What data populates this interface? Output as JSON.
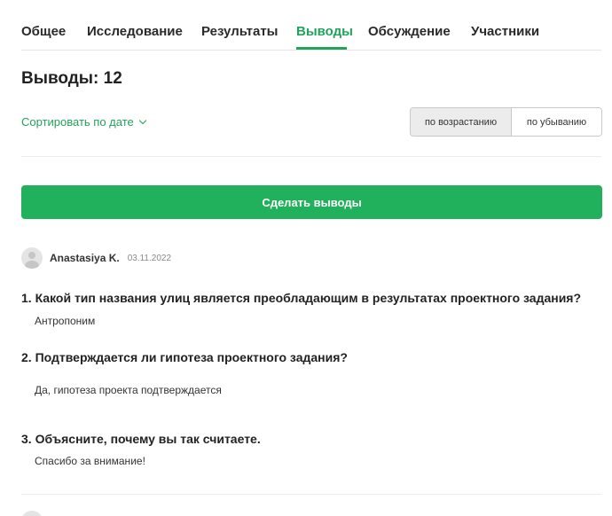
{
  "tabs": [
    {
      "label": "Общее"
    },
    {
      "label": "Исследование"
    },
    {
      "label": "Результаты"
    },
    {
      "label": "Выводы",
      "active": true
    },
    {
      "label": "Обсуждение"
    },
    {
      "label": "Участники"
    }
  ],
  "header": {
    "title": "Выводы: 12"
  },
  "sort": {
    "label": "Сортировать по дате",
    "asc_label": "по возрастанию",
    "desc_label": "по убыванию",
    "selected": "asc"
  },
  "actions": {
    "make_conclusions": "Сделать выводы"
  },
  "entry": {
    "author": "Anastasiya K.",
    "date": "03.11.2022",
    "questions": [
      {
        "q": "1. Какой тип названия улиц является преобладающим в результатах проектного задания?",
        "a": "Антропоним"
      },
      {
        "q": "2. Подтверждается ли гипотеза проектного задания?",
        "a": "Да, гипотеза проекта подтверждается"
      },
      {
        "q": "3. Объясните, почему вы так считаете.",
        "a": "Спасибо за внимание!"
      }
    ]
  },
  "colors": {
    "accent": "#21a35b",
    "button": "#21b05c"
  },
  "icons": [
    "chevron-down-icon",
    "avatar-icon"
  ]
}
